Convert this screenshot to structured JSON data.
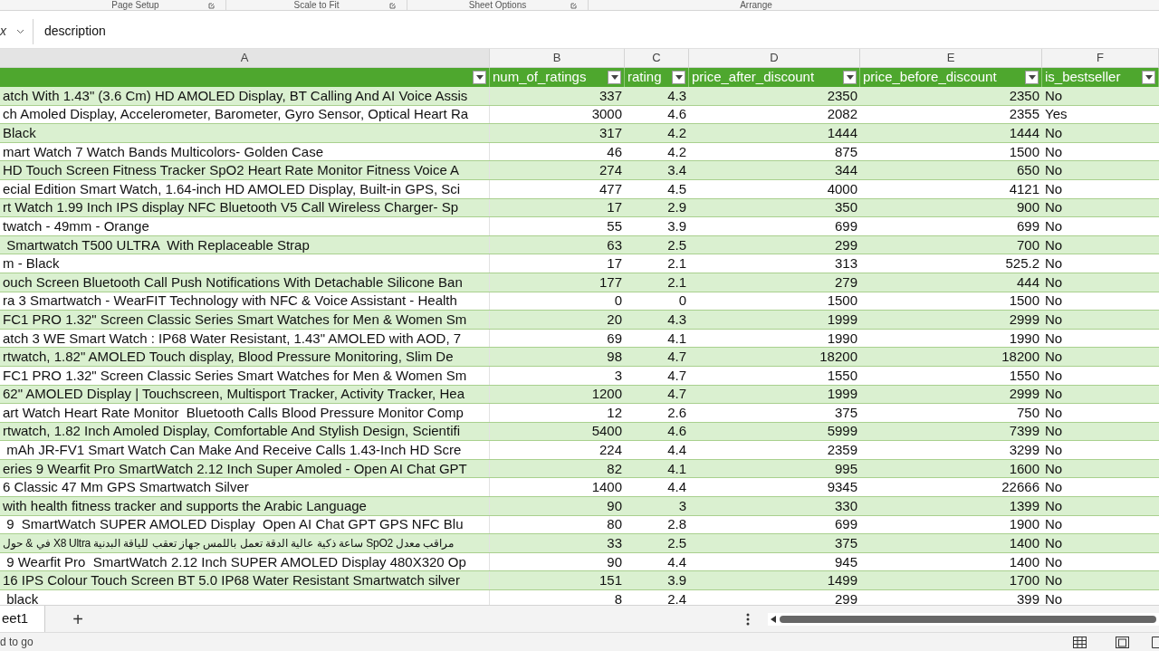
{
  "ribbon_groups": [
    {
      "label": "Page Setup"
    },
    {
      "label": "Scale to Fit"
    },
    {
      "label": "Sheet Options"
    },
    {
      "label": "Arrange"
    }
  ],
  "formula_bar": {
    "fx": "x",
    "value": "description"
  },
  "column_letters": [
    "A",
    "B",
    "C",
    "D",
    "E",
    "F"
  ],
  "columns": [
    {},
    {
      "header": "num_of_ratings"
    },
    {
      "header": "rating"
    },
    {
      "header": "price_after_discount"
    },
    {
      "header": "price_before_discount"
    },
    {
      "header": "is_bestseller"
    }
  ],
  "rows": [
    [
      "atch With 1.43\" (3.6 Cm) HD AMOLED Display, BT Calling And AI Voice Assis",
      "337",
      "4.3",
      "2350",
      "2350",
      "No"
    ],
    [
      "ch Amoled Display, Accelerometer, Barometer, Gyro Sensor, Optical Heart Ra",
      "3000",
      "4.6",
      "2082",
      "2355",
      "Yes"
    ],
    [
      "Black",
      "317",
      "4.2",
      "1444",
      "1444",
      "No"
    ],
    [
      "mart Watch 7 Watch Bands Multicolors- Golden Case",
      "46",
      "4.2",
      "875",
      "1500",
      "No"
    ],
    [
      "HD Touch Screen Fitness Tracker SpO2 Heart Rate Monitor Fitness Voice A",
      "274",
      "3.4",
      "344",
      "650",
      "No"
    ],
    [
      "ecial Edition Smart Watch, 1.64-inch HD AMOLED Display, Built-in GPS, Sci",
      "477",
      "4.5",
      "4000",
      "4121",
      "No"
    ],
    [
      "rt Watch 1.99 Inch IPS display NFC Bluetooth V5 Call Wireless Charger- Sp",
      "17",
      "2.9",
      "350",
      "900",
      "No"
    ],
    [
      "twatch - 49mm - Orange",
      "55",
      "3.9",
      "699",
      "699",
      "No"
    ],
    [
      " Smartwatch T500 ULTRA  With Replaceable Strap",
      "63",
      "2.5",
      "299",
      "700",
      "No"
    ],
    [
      "m - Black",
      "17",
      "2.1",
      "313",
      "525.2",
      "No"
    ],
    [
      "ouch Screen Bluetooth Call Push Notifications With Detachable Silicone Ban",
      "177",
      "2.1",
      "279",
      "444",
      "No"
    ],
    [
      "ra 3 Smartwatch - WearFIT Technology with NFC & Voice Assistant - Health",
      "0",
      "0",
      "1500",
      "1500",
      "No"
    ],
    [
      "FC1 PRO 1.32\" Screen Classic Series Smart Watches for Men & Women Sm",
      "20",
      "4.3",
      "1999",
      "2999",
      "No"
    ],
    [
      "atch 3 WE Smart Watch : IP68 Water Resistant, 1.43\" AMOLED with AOD, 7",
      "69",
      "4.1",
      "1990",
      "1990",
      "No"
    ],
    [
      "rtwatch, 1.82\" AMOLED Touch display, Blood Pressure Monitoring, Slim De",
      "98",
      "4.7",
      "18200",
      "18200",
      "No"
    ],
    [
      "FC1 PRO 1.32\" Screen Classic Series Smart Watches for Men & Women Sm",
      "3",
      "4.7",
      "1550",
      "1550",
      "No"
    ],
    [
      "62\" AMOLED Display | Touchscreen, Multisport Tracker, Activity Tracker, Hea",
      "1200",
      "4.7",
      "1999",
      "2999",
      "No"
    ],
    [
      "art Watch Heart Rate Monitor  Bluetooth Calls Blood Pressure Monitor Comp",
      "12",
      "2.6",
      "375",
      "750",
      "No"
    ],
    [
      "rtwatch, 1.82 Inch Amoled Display, Comfortable And Stylish Design, Scientifi",
      "5400",
      "4.6",
      "5999",
      "7399",
      "No"
    ],
    [
      " mAh JR-FV1 Smart Watch Can Make And Receive Calls 1.43-Inch HD Scre",
      "224",
      "4.4",
      "2359",
      "3299",
      "No"
    ],
    [
      "eries 9 Wearfit Pro SmartWatch 2.12 Inch Super Amoled - Open AI Chat GPT",
      "82",
      "4.1",
      "995",
      "1600",
      "No"
    ],
    [
      "6 Classic 47 Mm GPS Smartwatch Silver",
      "1400",
      "4.4",
      "9345",
      "22666",
      "No"
    ],
    [
      "with health fitness tracker and supports the Arabic Language",
      "90",
      "3",
      "330",
      "1399",
      "No"
    ],
    [
      " 9  SmartWatch SUPER AMOLED Display  Open AI Chat GPT GPS NFC Blu",
      "80",
      "2.8",
      "699",
      "1900",
      "No"
    ],
    [
      "في & حول X8 Ultra ساعة ذكية عالية الدقة تعمل باللمس جهاز تعقب للياقة البدنية SpO2 مراقب معدل",
      "33",
      "2.5",
      "375",
      "1400",
      "No"
    ],
    [
      " 9 Wearfit Pro  SmartWatch 2.12 Inch SUPER AMOLED Display 480X320 Op",
      "90",
      "4.4",
      "945",
      "1400",
      "No"
    ],
    [
      "16 IPS Colour Touch Screen BT 5.0 IP68 Water Resistant Smartwatch silver",
      "151",
      "3.9",
      "1499",
      "1700",
      "No"
    ],
    [
      " black",
      "8",
      "2.4",
      "299",
      "399",
      "No"
    ]
  ],
  "sheet_tabs": [
    {
      "label": "eet1",
      "selected": true
    }
  ],
  "add_sheet": "+",
  "status_bar": {
    "text": "d to go"
  }
}
